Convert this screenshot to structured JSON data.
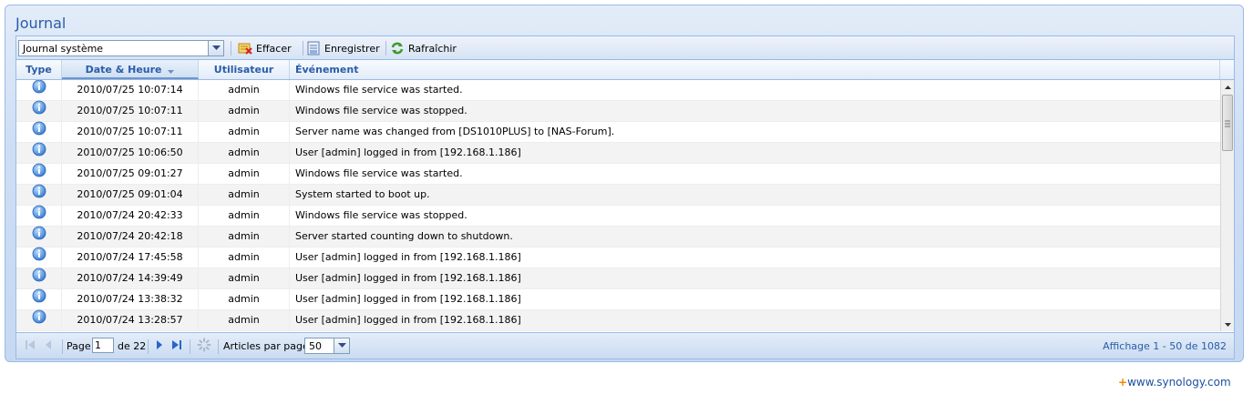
{
  "panel": {
    "title": "Journal"
  },
  "toolbar": {
    "log_select": "Journal système",
    "clear_label": "Effacer",
    "save_label": "Enregistrer",
    "refresh_label": "Rafraîchir"
  },
  "columns": {
    "type": "Type",
    "date": "Date & Heure",
    "user": "Utilisateur",
    "event": "Événement"
  },
  "rows": [
    {
      "icon": "info-icon",
      "date": "2010/07/25 10:07:14",
      "user": "admin",
      "event": "Windows file service was started."
    },
    {
      "icon": "info-icon",
      "date": "2010/07/25 10:07:11",
      "user": "admin",
      "event": "Windows file service was stopped."
    },
    {
      "icon": "info-icon",
      "date": "2010/07/25 10:07:11",
      "user": "admin",
      "event": "Server name was changed from [DS1010PLUS] to [NAS-Forum]."
    },
    {
      "icon": "info-icon",
      "date": "2010/07/25 10:06:50",
      "user": "admin",
      "event": "User [admin] logged in from [192.168.1.186]"
    },
    {
      "icon": "info-icon",
      "date": "2010/07/25 09:01:27",
      "user": "admin",
      "event": "Windows file service was started."
    },
    {
      "icon": "info-icon",
      "date": "2010/07/25 09:01:04",
      "user": "admin",
      "event": "System started to boot up."
    },
    {
      "icon": "info-icon",
      "date": "2010/07/24 20:42:33",
      "user": "admin",
      "event": "Windows file service was stopped."
    },
    {
      "icon": "info-icon",
      "date": "2010/07/24 20:42:18",
      "user": "admin",
      "event": "Server started counting down to shutdown."
    },
    {
      "icon": "info-icon",
      "date": "2010/07/24 17:45:58",
      "user": "admin",
      "event": "User [admin] logged in from [192.168.1.186]"
    },
    {
      "icon": "info-icon",
      "date": "2010/07/24 14:39:49",
      "user": "admin",
      "event": "User [admin] logged in from [192.168.1.186]"
    },
    {
      "icon": "info-icon",
      "date": "2010/07/24 13:38:32",
      "user": "admin",
      "event": "User [admin] logged in from [192.168.1.186]"
    },
    {
      "icon": "info-icon",
      "date": "2010/07/24 13:28:57",
      "user": "admin",
      "event": "User [admin] logged in from [192.168.1.186]"
    }
  ],
  "pager": {
    "page_label": "Page",
    "page_value": "1",
    "of_label": "de 22",
    "per_page_label": "Articles par page:",
    "per_page_value": "50",
    "display_info": "Affichage 1 - 50 de 1082"
  },
  "footer": {
    "plus": "+",
    "link": "www.synology.com"
  },
  "colors": {
    "accent": "#2a5ca8",
    "border": "#99bbe8",
    "info_icon": "#3a7fd5",
    "link": "#1d4fa0",
    "plus": "#f08a00"
  }
}
